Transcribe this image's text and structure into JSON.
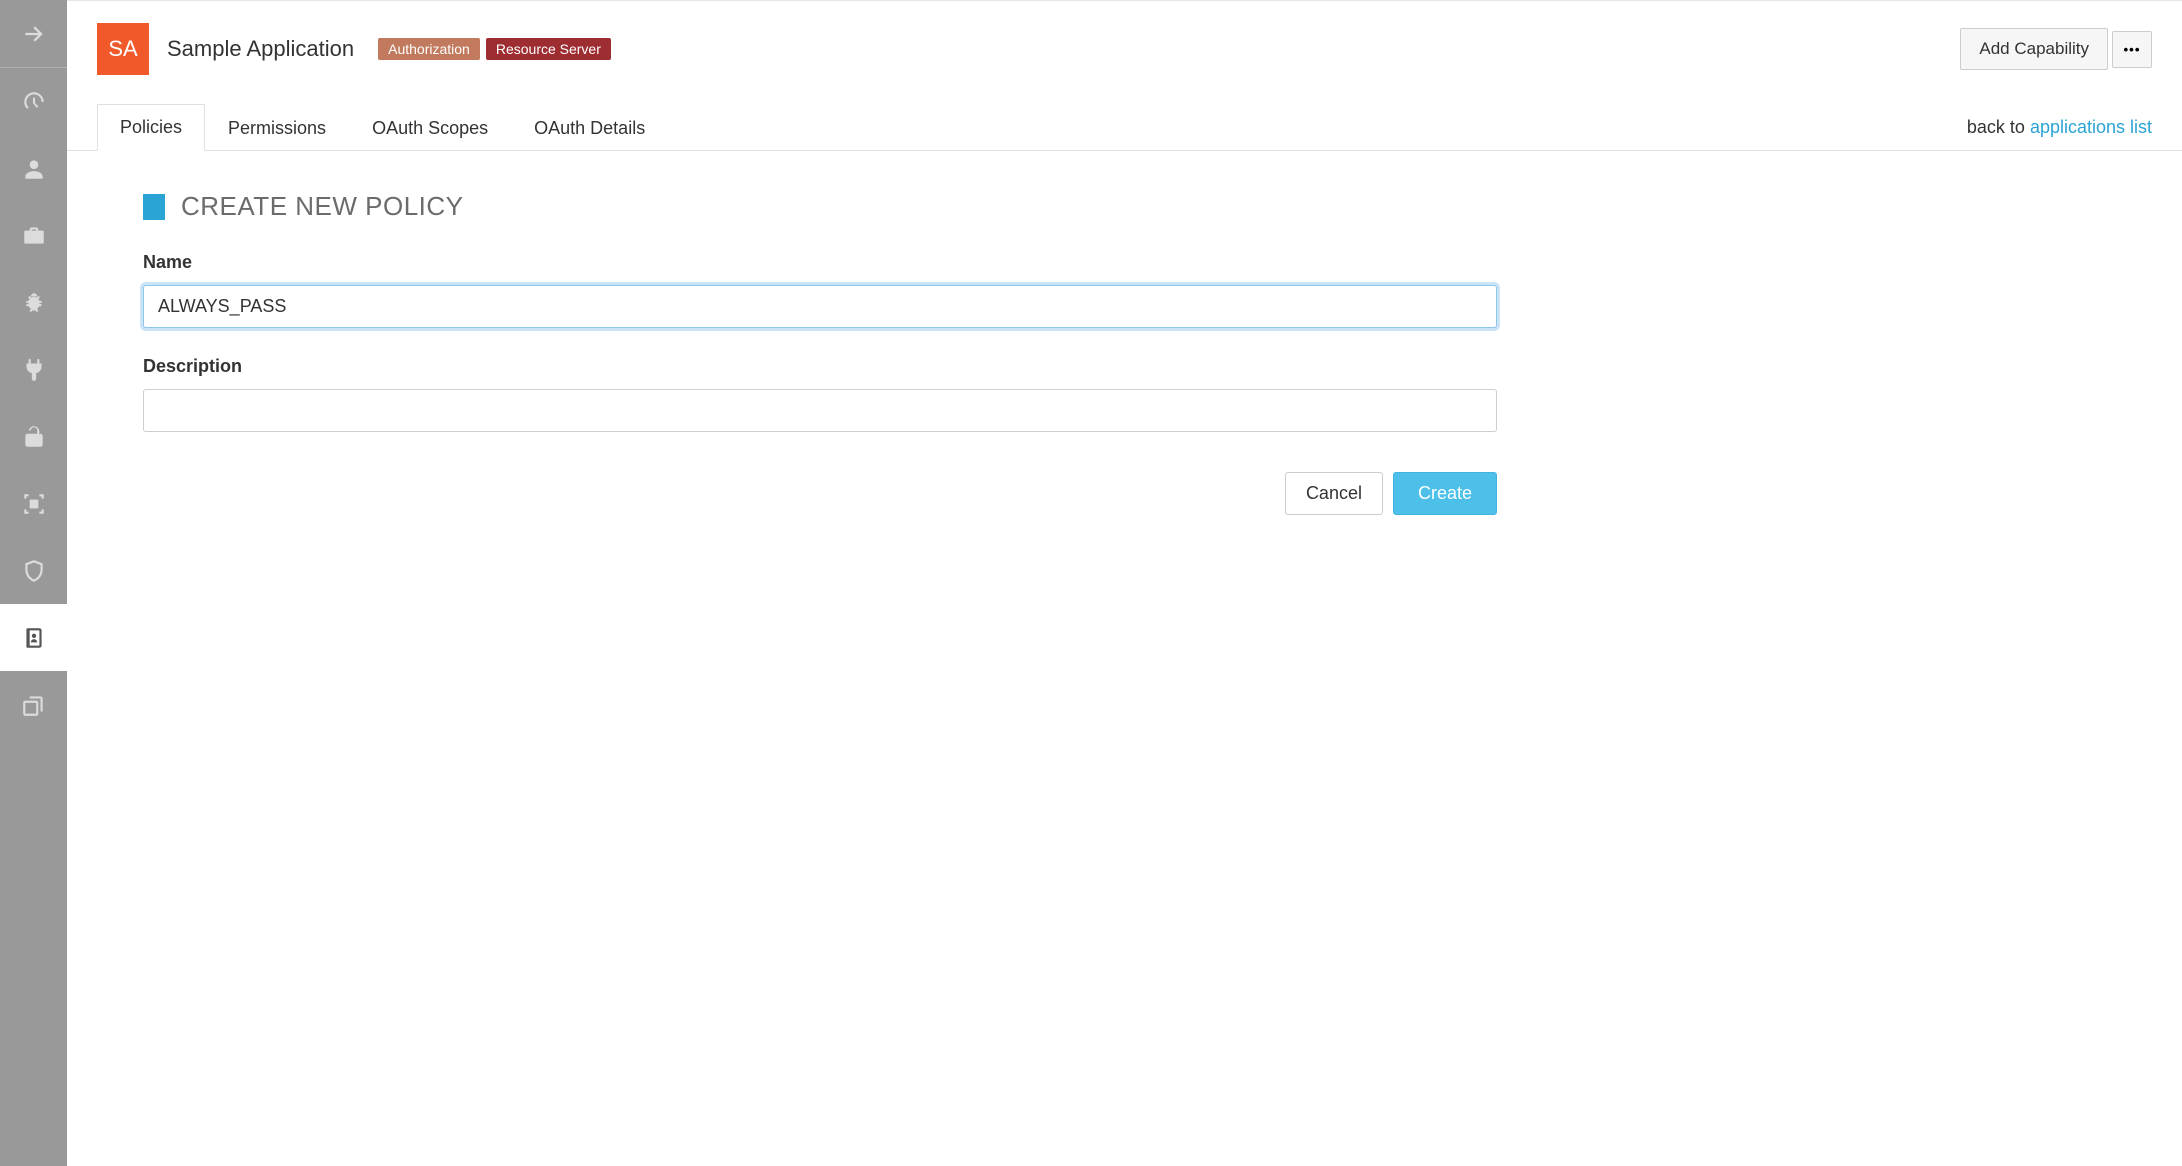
{
  "sidebar": {
    "icons": [
      "arrow-right",
      "dashboard",
      "user",
      "briefcase",
      "bug",
      "plug",
      "unlock",
      "group-select",
      "shield",
      "contacts",
      "copy"
    ]
  },
  "header": {
    "app_initials": "SA",
    "app_title": "Sample Application",
    "pill_authorization": "Authorization",
    "pill_resource_server": "Resource Server",
    "add_capability_label": "Add Capability",
    "more_glyph": "•••"
  },
  "tabs": {
    "items": [
      {
        "label": "Policies",
        "active": true
      },
      {
        "label": "Permissions",
        "active": false
      },
      {
        "label": "OAuth Scopes",
        "active": false
      },
      {
        "label": "OAuth Details",
        "active": false
      }
    ],
    "back_prefix": "back to ",
    "back_link_label": "applications list"
  },
  "form": {
    "section_title": "CREATE NEW POLICY",
    "name_label": "Name",
    "name_value": "ALWAYS_PASS",
    "description_label": "Description",
    "description_value": "",
    "cancel_label": "Cancel",
    "create_label": "Create"
  }
}
